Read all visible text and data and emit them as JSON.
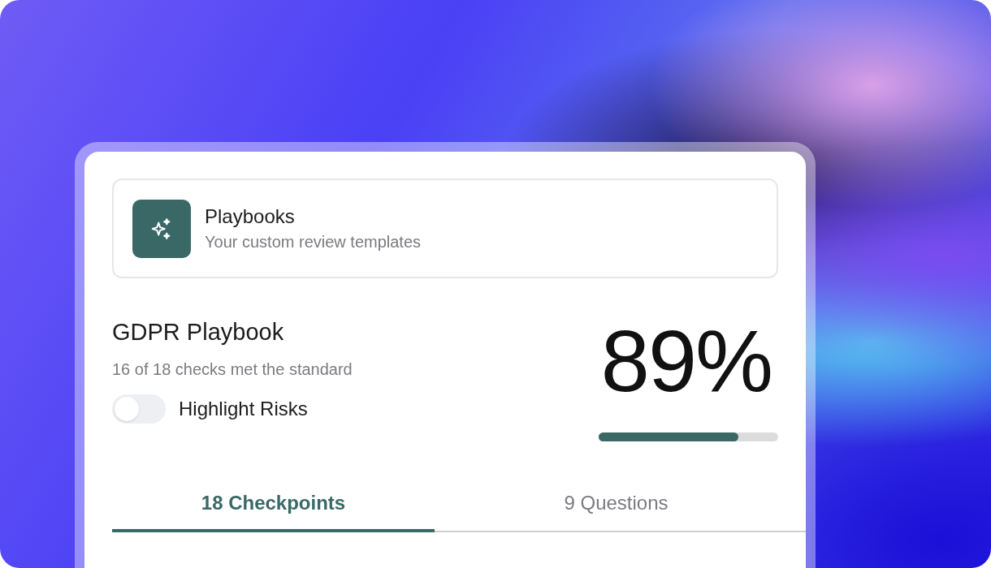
{
  "header_card": {
    "title": "Playbooks",
    "subtitle": "Your custom review templates"
  },
  "playbook": {
    "title": "GDPR Playbook",
    "summary": "16 of 18 checks met the standard",
    "score": "89%",
    "level": 0.78
  },
  "highlight_toggle": {
    "label": "Highlight Risks",
    "on": false
  },
  "tabs": [
    {
      "label": "18 Checkpoints",
      "selected": true
    },
    {
      "label": "9 Questions",
      "selected": false
    }
  ]
}
